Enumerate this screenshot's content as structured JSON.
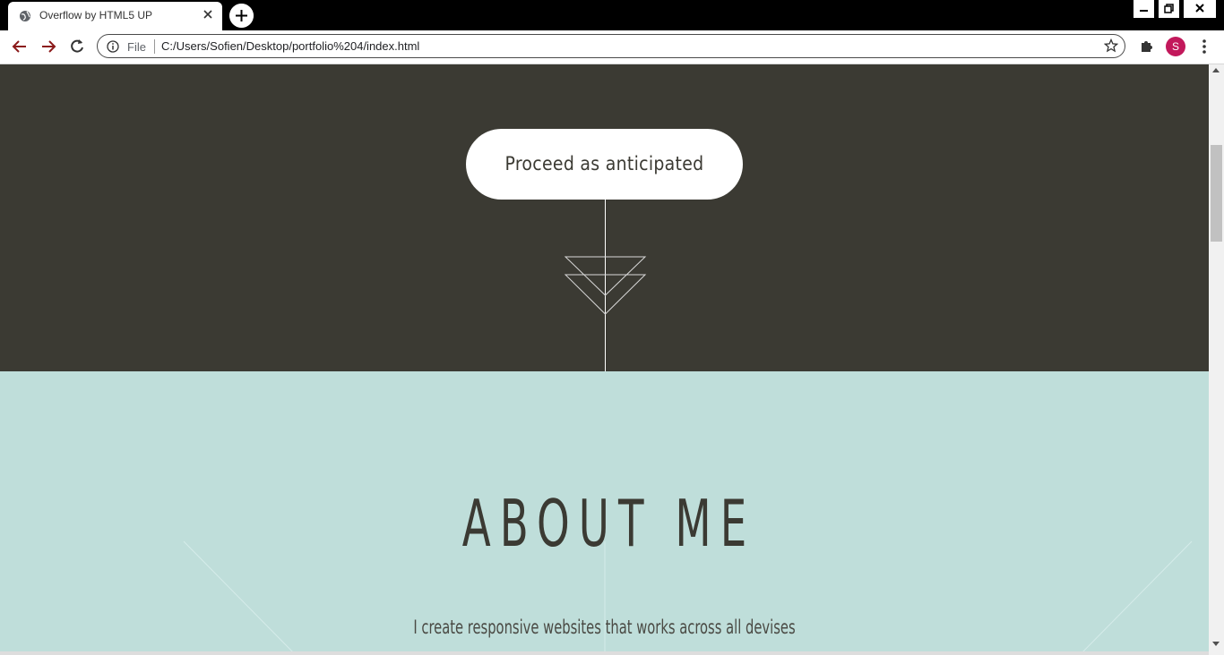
{
  "browser": {
    "tab_title": "Overflow by HTML5 UP",
    "omnibox": {
      "scheme_label": "File",
      "url": "C:/Users/Sofien/Desktop/portfolio%204/index.html"
    },
    "profile_initial": "S",
    "colors": {
      "profile": "#c2185b",
      "nav_arrows": "#8b1a1a"
    }
  },
  "page": {
    "intro_button": "Proceed as anticipated",
    "about_heading": "ABOUT ME",
    "about_tagline": "I create responsive websites that works across all devises",
    "colors": {
      "dark_section": "#3b3a33",
      "light_section": "#bfdeda",
      "text": "#3b3a33"
    }
  }
}
